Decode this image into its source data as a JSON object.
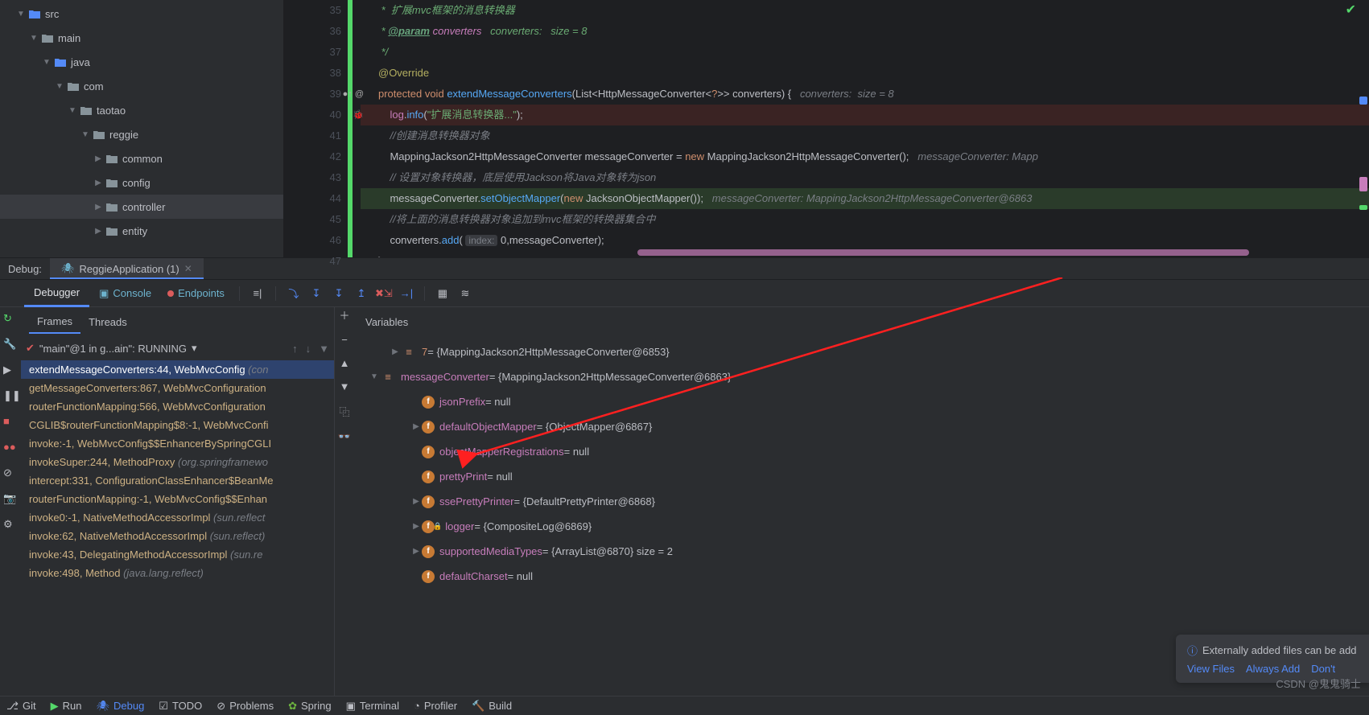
{
  "project_tree": {
    "src": "src",
    "main": "main",
    "java": "java",
    "com": "com",
    "taotao": "taotao",
    "reggie": "reggie",
    "common": "common",
    "config": "config",
    "controller": "controller",
    "entity": "entity"
  },
  "editor": {
    "lines": [
      {
        "n": "35",
        "html": "<span class='doc'> *  扩展mvc框架的消息转换器</span>"
      },
      {
        "n": "36",
        "html": "<span class='doc'> * <span class='doctag'>@param</span> <span class='param'>converters</span>   converters:   size = 8</span>"
      },
      {
        "n": "37",
        "html": "<span class='doc'> */</span>"
      },
      {
        "n": "38",
        "html": "<span class='an'>@Override</span>"
      },
      {
        "n": "39",
        "icons": "●↑ @",
        "html": "<span class='k'>protected</span> <span class='k'>void</span> <span class='m'>extendMessageConverters</span>(<span class='t'>List</span>&lt;<span class='t'>HttpMessageConverter</span>&lt;<span class='k'>?</span>&gt;&gt; converters) {   <span class='c'>converters:  size = 8</span>"
      },
      {
        "n": "40",
        "cls": "hl-red",
        "icons": "🐞",
        "html": "    <span class='param' style='font-style:normal'>log</span>.<span class='m'>info</span>(<span class='s'>\"扩展消息转换器...\"</span>);"
      },
      {
        "n": "41",
        "html": "    <span class='c'>//创建消息转换器对象</span>"
      },
      {
        "n": "42",
        "html": "    <span class='t'>MappingJackson2HttpMessageConverter</span> messageConverter = <span class='k'>new</span> <span class='t'>MappingJackson2HttpMessageConverter</span>();   <span class='c'>messageConverter: Mapp</span>"
      },
      {
        "n": "43",
        "html": "    <span class='c'>// 设置对象转换器，底层使用Jackson将Java对象转为json</span>"
      },
      {
        "n": "44",
        "cls": "hl-green",
        "html": "    messageConverter.<span class='m'>setObjectMapper</span>(<span class='k'>new</span> <span class='t'>JacksonObjectMapper</span>());   <span class='c'>messageConverter: MappingJackson2HttpMessageConverter@6863</span>"
      },
      {
        "n": "45",
        "html": "    <span class='c'>//将上面的消息转换器对象追加到mvc框架的转换器集合中</span>"
      },
      {
        "n": "46",
        "html": "    converters.<span class='m'>add</span>( <span class='inline-hint'>index:</span> 0,messageConverter);"
      },
      {
        "n": "47",
        "html": "}"
      }
    ]
  },
  "debug_label": "Debug:",
  "run_config": "ReggieApplication (1)",
  "debugger_tabs": {
    "debugger": "Debugger",
    "console": "Console",
    "endpoints": "Endpoints"
  },
  "frames_tabs": {
    "frames": "Frames",
    "threads": "Threads"
  },
  "thread_dropdown": "\"main\"@1 in g...ain\": RUNNING",
  "frames": [
    {
      "text": "extendMessageConverters:44, WebMvcConfig",
      "grey": "(con",
      "sel": true
    },
    {
      "text": "getMessageConverters:867, WebMvcConfiguration",
      "grey": ""
    },
    {
      "text": "routerFunctionMapping:566, WebMvcConfiguration",
      "grey": ""
    },
    {
      "text": "CGLIB$routerFunctionMapping$8:-1, WebMvcConfi",
      "grey": ""
    },
    {
      "text": "invoke:-1, WebMvcConfig$$EnhancerBySpringCGLI",
      "grey": ""
    },
    {
      "text": "invokeSuper:244, MethodProxy",
      "grey": "(org.springframewo"
    },
    {
      "text": "intercept:331, ConfigurationClassEnhancer$BeanMe",
      "grey": ""
    },
    {
      "text": "routerFunctionMapping:-1, WebMvcConfig$$Enhan",
      "grey": ""
    },
    {
      "text": "invoke0:-1, NativeMethodAccessorImpl",
      "grey": "(sun.reflect"
    },
    {
      "text": "invoke:62, NativeMethodAccessorImpl",
      "grey": "(sun.reflect)"
    },
    {
      "text": "invoke:43, DelegatingMethodAccessorImpl",
      "grey": "(sun.re"
    },
    {
      "text": "invoke:498, Method",
      "grey": "(java.lang.reflect)"
    }
  ],
  "vars_header": "Variables",
  "variables": [
    {
      "indent": 1,
      "arrow": "▶",
      "icon": "≡",
      "name_cls": "orange",
      "name": "7",
      "val": " = {MappingJackson2HttpMessageConverter@6853}"
    },
    {
      "indent": 0,
      "arrow": "▼",
      "icon": "≡",
      "name": "messageConverter",
      "val": " = {MappingJackson2HttpMessageConverter@6863}"
    },
    {
      "indent": 2,
      "arrow": "",
      "icon": "f",
      "name": "jsonPrefix",
      "val": " = null"
    },
    {
      "indent": 2,
      "arrow": "▶",
      "icon": "f",
      "name": "defaultObjectMapper",
      "val": " = {ObjectMapper@6867}"
    },
    {
      "indent": 2,
      "arrow": "",
      "icon": "f",
      "name": "objectMapperRegistrations",
      "val": " = null"
    },
    {
      "indent": 2,
      "arrow": "",
      "icon": "f",
      "name": "prettyPrint",
      "val": " = null"
    },
    {
      "indent": 2,
      "arrow": "▶",
      "icon": "f",
      "name": "ssePrettyPrinter",
      "val": " = {DefaultPrettyPrinter@6868}"
    },
    {
      "indent": 2,
      "arrow": "▶",
      "icon": "f",
      "lock": true,
      "name": "logger",
      "val": " = {CompositeLog@6869}"
    },
    {
      "indent": 2,
      "arrow": "▶",
      "icon": "f",
      "name": "supportedMediaTypes",
      "val": " = {ArrayList@6870}  size = 2"
    },
    {
      "indent": 2,
      "arrow": "",
      "icon": "f",
      "name": "defaultCharset",
      "val": " = null"
    }
  ],
  "notification": {
    "title": "Externally added files can be add",
    "view": "View Files",
    "always": "Always Add",
    "dont": "Don't"
  },
  "statusbar": {
    "git": "Git",
    "run": "Run",
    "debug": "Debug",
    "todo": "TODO",
    "problems": "Problems",
    "spring": "Spring",
    "terminal": "Terminal",
    "profiler": "Profiler",
    "build": "Build"
  },
  "watermark": "CSDN @鬼鬼骑士"
}
